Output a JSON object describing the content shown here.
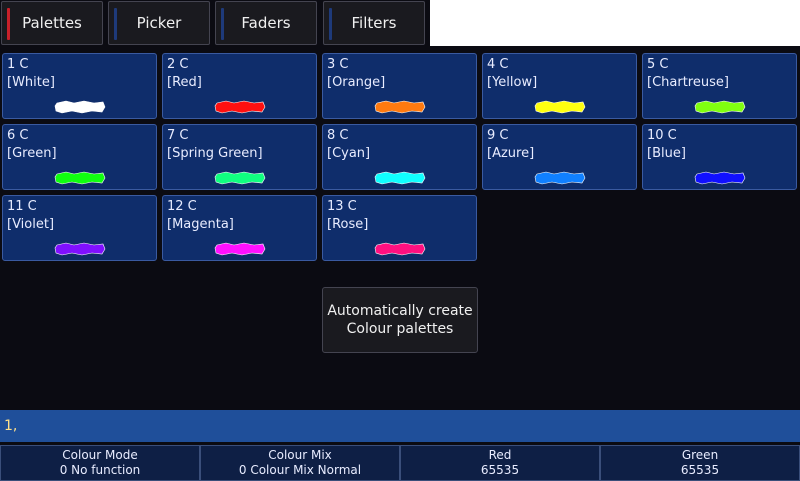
{
  "tabs": [
    {
      "label": "Palettes",
      "stripe": "#c8202a"
    },
    {
      "label": "Picker",
      "stripe": "#1e3a7a"
    },
    {
      "label": "Faders",
      "stripe": "#1e3a7a"
    },
    {
      "label": "Filters",
      "stripe": "#1e3a7a"
    }
  ],
  "palettes": [
    {
      "num": "1 C",
      "name": "[White]",
      "color": "#ffffff"
    },
    {
      "num": "2 C",
      "name": "[Red]",
      "color": "#ff1010"
    },
    {
      "num": "3 C",
      "name": "[Orange]",
      "color": "#ff7a10"
    },
    {
      "num": "4 C",
      "name": "[Yellow]",
      "color": "#ffff10"
    },
    {
      "num": "5 C",
      "name": "[Chartreuse]",
      "color": "#80ff10"
    },
    {
      "num": "6 C",
      "name": "[Green]",
      "color": "#10ff10"
    },
    {
      "num": "7 C",
      "name": "[Spring Green]",
      "color": "#10ff80"
    },
    {
      "num": "8 C",
      "name": "[Cyan]",
      "color": "#10ffff"
    },
    {
      "num": "9 C",
      "name": "[Azure]",
      "color": "#1080ff"
    },
    {
      "num": "10 C",
      "name": "[Blue]",
      "color": "#1010ff"
    },
    {
      "num": "11 C",
      "name": "[Violet]",
      "color": "#8010ff"
    },
    {
      "num": "12 C",
      "name": "[Magenta]",
      "color": "#ff10ff"
    },
    {
      "num": "13 C",
      "name": "[Rose]",
      "color": "#ff1080"
    }
  ],
  "auto_button": {
    "line1": "Automatically create",
    "line2": "Colour palettes"
  },
  "command_line": "1,",
  "attributes": [
    {
      "name": "Colour Mode",
      "value": "0 No function"
    },
    {
      "name": "Colour Mix",
      "value": "0 Colour Mix Normal"
    },
    {
      "name": "Red",
      "value": "65535"
    },
    {
      "name": "Green",
      "value": "65535"
    }
  ]
}
